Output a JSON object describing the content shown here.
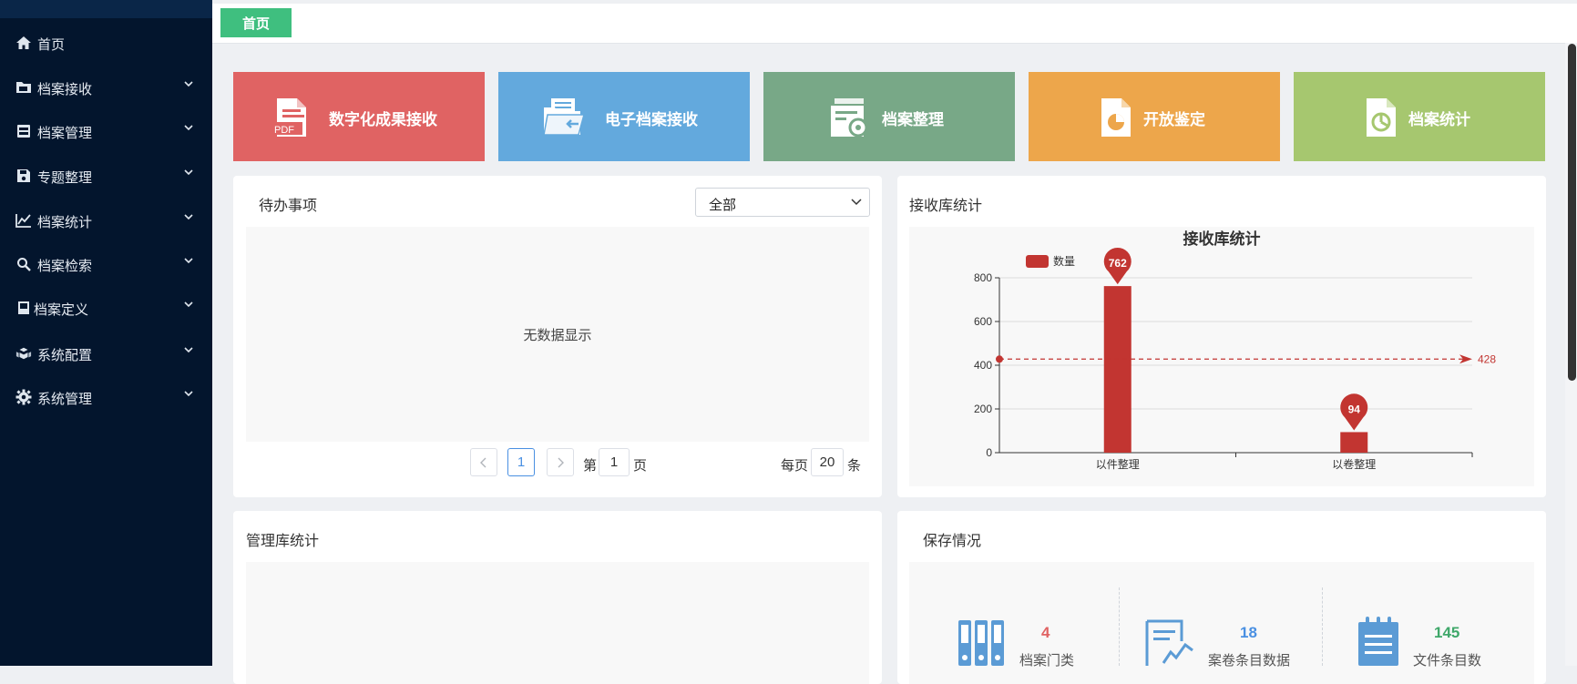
{
  "sidebar": {
    "items": [
      {
        "label": "首页",
        "icon": "home-icon",
        "expandable": false
      },
      {
        "label": "档案接收",
        "icon": "folder-icon",
        "expandable": true
      },
      {
        "label": "档案管理",
        "icon": "cabinet-icon",
        "expandable": true
      },
      {
        "label": "专题整理",
        "icon": "save-icon",
        "expandable": true
      },
      {
        "label": "档案统计",
        "icon": "line-chart-icon",
        "expandable": true
      },
      {
        "label": "档案检索",
        "icon": "search-icon",
        "expandable": true
      },
      {
        "label": "档案定义",
        "icon": "form-icon",
        "expandable": true
      },
      {
        "label": "系统配置",
        "icon": "cubes-icon",
        "expandable": true
      },
      {
        "label": "系统管理",
        "icon": "gear-icon",
        "expandable": true
      }
    ]
  },
  "tabs": {
    "home": "首页"
  },
  "tiles": [
    {
      "label": "数字化成果接收",
      "icon": "pdf-file-icon",
      "color": "#e06363"
    },
    {
      "label": "电子档案接收",
      "icon": "folder-import-icon",
      "color": "#63a9dd"
    },
    {
      "label": "档案整理",
      "icon": "archive-settings-icon",
      "color": "#78a887"
    },
    {
      "label": "开放鉴定",
      "icon": "pie-file-icon",
      "color": "#eda64b"
    },
    {
      "label": "档案统计",
      "icon": "chart-file-icon",
      "color": "#a6c76f"
    }
  ],
  "todo": {
    "title": "待办事项",
    "filter_value": "全部",
    "empty_text": "无数据显示",
    "pagination": {
      "current_page": "1",
      "page_prefix": "第",
      "page_input": "1",
      "page_suffix": "页",
      "per_page_prefix": "每页",
      "per_page": "20",
      "per_page_suffix": "条"
    }
  },
  "receive_stats": {
    "title": "接收库统计",
    "chart_data": {
      "type": "bar",
      "title": "接收库统计",
      "legend": "数量",
      "legend_position": "top-left",
      "categories": [
        "以件整理",
        "以卷整理"
      ],
      "series": [
        {
          "name": "数量",
          "values": [
            762,
            94
          ],
          "color": "#c23531"
        }
      ],
      "ylim": [
        0,
        800
      ],
      "yticks": [
        0,
        200,
        400,
        600,
        800
      ],
      "mark_points": [
        "762",
        "94"
      ],
      "mark_line": {
        "label": "428",
        "value": 428
      },
      "grid": true
    }
  },
  "manage_stats": {
    "title": "管理库统计"
  },
  "storage": {
    "title": "保存情况",
    "items": [
      {
        "value": "4",
        "label": "档案门类",
        "icon": "binders-icon",
        "color": "#e06363"
      },
      {
        "value": "18",
        "label": "案卷条目数据",
        "icon": "document-chart-icon",
        "color": "#4a90e2"
      },
      {
        "value": "145",
        "label": "文件条目数",
        "icon": "notepad-icon",
        "color": "#3fa86a"
      }
    ]
  }
}
